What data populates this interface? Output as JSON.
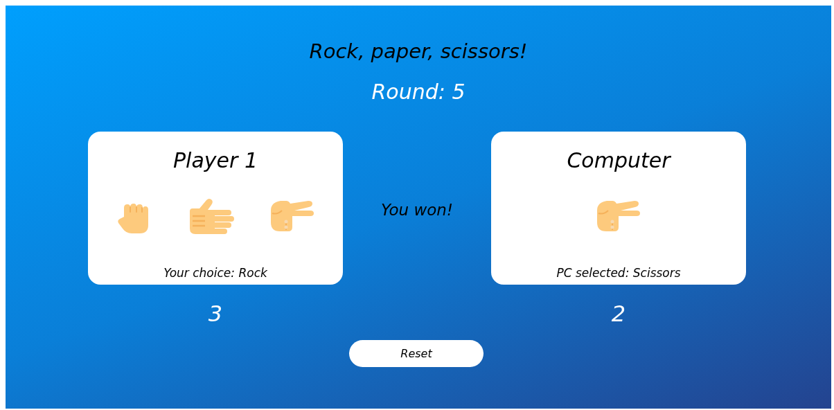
{
  "title": "Rock, paper, scissors!",
  "round": "Round: 5",
  "player": {
    "name": "Player 1",
    "choices": [
      {
        "kind": "rock"
      },
      {
        "kind": "paper"
      },
      {
        "kind": "scissors"
      }
    ],
    "caption": "Your choice: Rock",
    "score": "3"
  },
  "result": "You won!",
  "computer": {
    "name": "Computer",
    "choices": [
      {
        "kind": "scissors"
      }
    ],
    "caption": "PC selected: Scissors",
    "score": "2"
  },
  "reset_button": "Reset"
}
